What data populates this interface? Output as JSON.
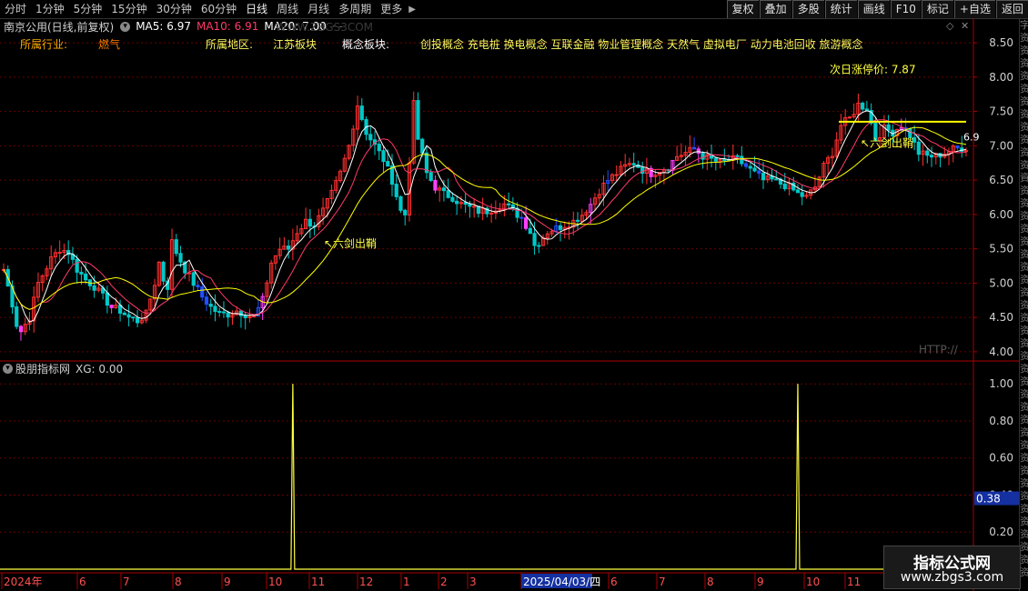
{
  "toolbar": {
    "periods": [
      "分时",
      "1分钟",
      "5分钟",
      "15分钟",
      "30分钟",
      "60分钟",
      "日线",
      "周线",
      "月线",
      "多周期",
      "更多"
    ],
    "active_period": "日线",
    "buttons": [
      "复权",
      "叠加",
      "多股",
      "统计",
      "画线",
      "F10",
      "标记",
      "+自选",
      "返回"
    ]
  },
  "legend": {
    "stock_title": "南京公用(日线,前复权)",
    "ma5": "MA5: 6.97",
    "ma10": "MA10: 6.91",
    "ma20": "MA20: 7.00",
    "extra": "· -",
    "watermark_url": "WWW.ZBGS3COM",
    "colors": {
      "ma5": "#ffffff",
      "ma10": "#ff3a6a",
      "ma20": "#ffff00"
    }
  },
  "info": {
    "industry_label": "所属行业:",
    "industry_value": "燃气",
    "region_label": "所属地区:",
    "region_value": "江苏板块",
    "concept_label": "概念板块:",
    "concept_value": "创投概念 充电桩 换电概念 互联金融 物业管理概念 天然气 虚拟电厂 动力电池回收 旅游概念"
  },
  "annotations": {
    "limit_up": "次日涨停价: 7.87",
    "signal1": "六剑出鞘",
    "signal2": "六剑出鞘",
    "last_value": "6.9",
    "http": "HTTP://",
    "current_value_box": "0.38"
  },
  "sub": {
    "title": "股朋指标网",
    "xg": "XG: 0.00"
  },
  "watermark": {
    "line1": "指标公式网",
    "line2": "www.zbgs3.com"
  },
  "chart_data": [
    {
      "type": "candlestick",
      "title": "南京公用(日线,前复权)",
      "y_ticks": [
        4.0,
        4.5,
        5.0,
        5.5,
        6.0,
        6.5,
        7.0,
        7.5,
        8.0,
        8.5
      ],
      "ylim": [
        3.88,
        8.62
      ],
      "x_ticks": [
        "2024年",
        "6",
        "7",
        "8",
        "9",
        "10",
        "11",
        "12",
        "1",
        "2",
        "3",
        "2025/04/03/四",
        "6",
        "7",
        "8",
        "9",
        "10",
        "11"
      ],
      "close_path": [
        [
          0,
          5.2
        ],
        [
          2,
          4.7
        ],
        [
          3,
          4.4
        ],
        [
          4,
          4.3
        ],
        [
          6,
          4.5
        ],
        [
          8,
          5.0
        ],
        [
          11,
          5.35
        ],
        [
          13,
          5.5
        ],
        [
          15,
          5.45
        ],
        [
          17,
          5.2
        ],
        [
          19,
          5.05
        ],
        [
          21,
          4.95
        ],
        [
          23,
          4.8
        ],
        [
          25,
          4.65
        ],
        [
          27,
          4.6
        ],
        [
          29,
          4.5
        ],
        [
          31,
          4.45
        ],
        [
          33,
          4.55
        ],
        [
          35,
          5.0
        ],
        [
          36,
          5.3
        ],
        [
          37,
          5.05
        ],
        [
          38,
          4.95
        ],
        [
          39,
          5.6
        ],
        [
          40,
          5.45
        ],
        [
          42,
          5.2
        ],
        [
          44,
          5.0
        ],
        [
          46,
          4.8
        ],
        [
          48,
          4.65
        ],
        [
          50,
          4.55
        ],
        [
          52,
          4.55
        ],
        [
          54,
          4.6
        ],
        [
          56,
          4.55
        ],
        [
          58,
          4.5
        ],
        [
          60,
          4.75
        ],
        [
          62,
          5.3
        ],
        [
          64,
          5.5
        ],
        [
          66,
          5.5
        ],
        [
          68,
          5.75
        ],
        [
          70,
          5.9
        ],
        [
          72,
          5.85
        ],
        [
          74,
          6.05
        ],
        [
          76,
          6.3
        ],
        [
          78,
          6.6
        ],
        [
          80,
          7.0
        ],
        [
          82,
          7.6
        ],
        [
          84,
          7.2
        ],
        [
          86,
          7.0
        ],
        [
          88,
          6.8
        ],
        [
          90,
          6.5
        ],
        [
          92,
          6.05
        ],
        [
          93,
          6.0
        ],
        [
          95,
          7.6
        ],
        [
          96,
          7.1
        ],
        [
          98,
          6.6
        ],
        [
          100,
          6.4
        ],
        [
          102,
          6.3
        ],
        [
          104,
          6.25
        ],
        [
          106,
          6.15
        ],
        [
          108,
          6.1
        ],
        [
          110,
          6.05
        ],
        [
          112,
          6.05
        ],
        [
          114,
          6.1
        ],
        [
          116,
          6.15
        ],
        [
          118,
          6.05
        ],
        [
          120,
          5.95
        ],
        [
          122,
          5.75
        ],
        [
          123,
          5.55
        ],
        [
          124,
          5.6
        ],
        [
          126,
          5.75
        ],
        [
          128,
          5.8
        ],
        [
          130,
          5.85
        ],
        [
          132,
          5.9
        ],
        [
          134,
          6.0
        ],
        [
          136,
          6.15
        ],
        [
          138,
          6.35
        ],
        [
          140,
          6.5
        ],
        [
          142,
          6.6
        ],
        [
          144,
          6.7
        ],
        [
          146,
          6.75
        ],
        [
          148,
          6.65
        ],
        [
          150,
          6.6
        ],
        [
          152,
          6.65
        ],
        [
          154,
          6.7
        ],
        [
          156,
          6.85
        ],
        [
          158,
          6.9
        ],
        [
          160,
          6.95
        ],
        [
          162,
          6.85
        ],
        [
          164,
          6.8
        ],
        [
          166,
          6.75
        ],
        [
          168,
          6.8
        ],
        [
          170,
          6.8
        ],
        [
          172,
          6.7
        ],
        [
          174,
          6.6
        ],
        [
          176,
          6.5
        ],
        [
          178,
          6.5
        ],
        [
          180,
          6.45
        ],
        [
          182,
          6.4
        ],
        [
          184,
          6.3
        ],
        [
          186,
          6.25
        ],
        [
          188,
          6.4
        ],
        [
          190,
          6.7
        ],
        [
          192,
          6.9
        ],
        [
          194,
          7.3
        ],
        [
          196,
          7.4
        ],
        [
          198,
          7.6
        ],
        [
          200,
          7.55
        ],
        [
          202,
          7.1
        ],
        [
          204,
          7.25
        ],
        [
          206,
          7.2
        ],
        [
          208,
          7.3
        ],
        [
          210,
          7.15
        ],
        [
          212,
          6.9
        ],
        [
          214,
          6.85
        ],
        [
          216,
          6.85
        ],
        [
          218,
          6.9
        ],
        [
          220,
          6.95
        ],
        [
          222,
          6.97
        ]
      ],
      "limit_up_price": 7.87,
      "signal_level": 7.35
    },
    {
      "type": "line",
      "title": "XG",
      "y_ticks": [
        0.2,
        0.4,
        0.6,
        0.8,
        1.0
      ],
      "ylim": [
        0.0,
        1.05
      ],
      "spikes_at": [
        67,
        184
      ],
      "spike_value": 1.0
    }
  ]
}
